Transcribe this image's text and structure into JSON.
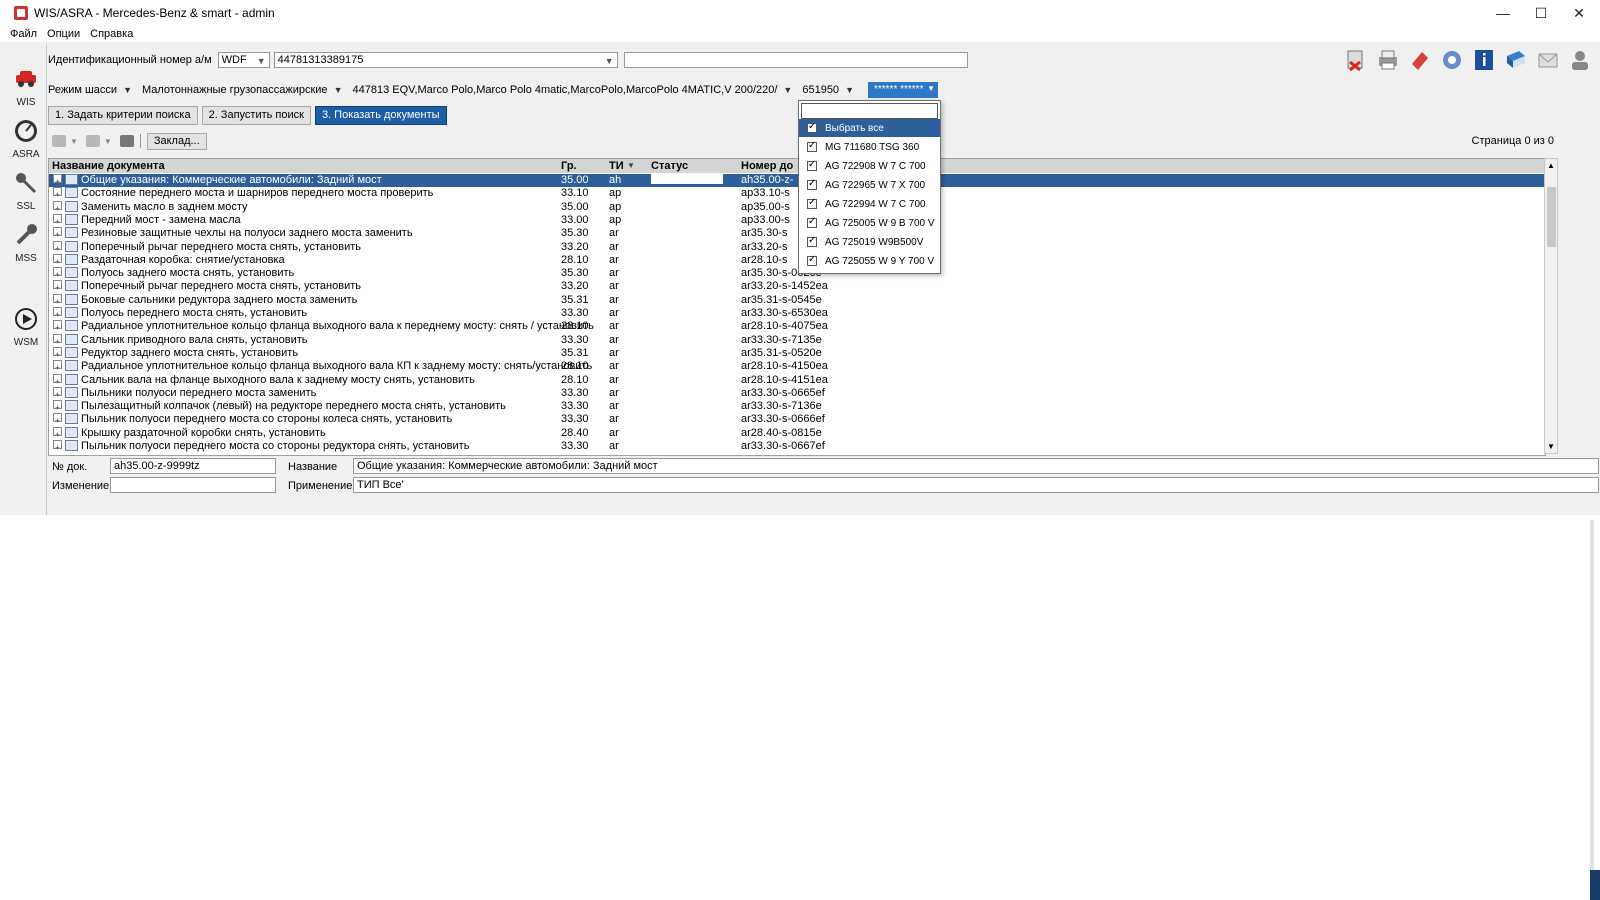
{
  "window": {
    "title": "WIS/ASRA - Mercedes-Benz & smart - admin"
  },
  "menu": [
    "Файл",
    "Опции",
    "Справка"
  ],
  "sidebar": [
    {
      "label": "WIS",
      "icon": "car-icon"
    },
    {
      "label": "ASRA",
      "icon": "gauge-icon"
    },
    {
      "label": "SSL",
      "icon": "key-icon"
    },
    {
      "label": "MSS",
      "icon": "wrench-icon"
    },
    {
      "label": "WSM",
      "icon": "play-icon"
    }
  ],
  "vin": {
    "label": "Идентификационный номер а/м",
    "prefix": "WDF",
    "number": "44781313389175"
  },
  "toolbar_icons": [
    "delete-icon",
    "print-icon",
    "eraser-icon",
    "settings-icon",
    "info-icon",
    "book-icon",
    "mail-icon",
    "user-icon"
  ],
  "criteria": {
    "mode": "Режим шасси",
    "category": "Малотоннажные грузопассажирские",
    "model": "447813 EQV,Marco Polo,Marco Polo 4matic,MarcoPolo,MarcoPolo 4MATIC,V 200/220/",
    "code": "651950",
    "extra": "****** ******"
  },
  "steps": [
    {
      "label": "1. Задать критерии поиска"
    },
    {
      "label": "2. Запустить поиск"
    },
    {
      "label": "3. Показать документы"
    }
  ],
  "bookmark_label": "Заклад...",
  "page_info": "Страница 0 из 0",
  "table": {
    "headers": [
      "Название документа",
      "Гр.",
      "ТИ",
      "Статус",
      "Номер до"
    ],
    "rows": [
      {
        "name": "Общие указания: Коммерческие автомобили: Задний мост",
        "gr": "35.00",
        "ti": "ah",
        "num": "ah35.00-z-",
        "selected": true
      },
      {
        "name": "Состояние переднего моста и шарниров переднего моста проверить",
        "gr": "33.10",
        "ti": "ap",
        "num": "ap33.10-s"
      },
      {
        "name": "Заменить масло в заднем мосту",
        "gr": "35.00",
        "ti": "ap",
        "num": "ap35.00-s"
      },
      {
        "name": "Передний мост - замена масла",
        "gr": "33.00",
        "ti": "ap",
        "num": "ap33.00-s"
      },
      {
        "name": "Резиновые защитные чехлы на полуоси заднего моста заменить",
        "gr": "35.30",
        "ti": "ar",
        "num": "ar35.30-s"
      },
      {
        "name": "Поперечный рычаг переднего моста снять, установить",
        "gr": "33.20",
        "ti": "ar",
        "num": "ar33.20-s"
      },
      {
        "name": "Раздаточная коробка: снятие/установка",
        "gr": "28.10",
        "ti": "ar",
        "num": "ar28.10-s"
      },
      {
        "name": "Полуось заднего моста снять, установить",
        "gr": "35.30",
        "ti": "ar",
        "num": "ar35.30-s-0620e"
      },
      {
        "name": "Поперечный рычаг переднего моста снять, установить",
        "gr": "33.20",
        "ti": "ar",
        "num": "ar33.20-s-1452ea"
      },
      {
        "name": "Боковые сальники редуктора заднего моста заменить",
        "gr": "35.31",
        "ti": "ar",
        "num": "ar35.31-s-0545e"
      },
      {
        "name": "Полуось переднего моста снять, установить",
        "gr": "33.30",
        "ti": "ar",
        "num": "ar33.30-s-6530ea"
      },
      {
        "name": "Радиальное уплотнительное кольцо фланца выходного вала к переднему мосту: снять / установить",
        "gr": "28.10",
        "ti": "ar",
        "num": "ar28.10-s-4075ea"
      },
      {
        "name": "Сальник приводного вала снять, установить",
        "gr": "33.30",
        "ti": "ar",
        "num": "ar33.30-s-7135e"
      },
      {
        "name": "Редуктор заднего моста снять, установить",
        "gr": "35.31",
        "ti": "ar",
        "num": "ar35.31-s-0520e"
      },
      {
        "name": "Радиальное уплотнительное кольцо фланца выходного вала КП к заднему мосту: снять/установить",
        "gr": "28.10",
        "ti": "ar",
        "num": "ar28.10-s-4150ea"
      },
      {
        "name": "Сальник вала на фланце выходного вала к заднему мосту снять, установить",
        "gr": "28.10",
        "ti": "ar",
        "num": "ar28.10-s-4151ea"
      },
      {
        "name": "Пыльники полуоси переднего моста заменить",
        "gr": "33.30",
        "ti": "ar",
        "num": "ar33.30-s-0665ef"
      },
      {
        "name": "Пылезащитный колпачок (левый) на редукторе переднего моста снять, установить",
        "gr": "33.30",
        "ti": "ar",
        "num": "ar33.30-s-7136e"
      },
      {
        "name": "Пыльник полуоси переднего моста со стороны колеса снять, установить",
        "gr": "33.30",
        "ti": "ar",
        "num": "ar33.30-s-0666ef"
      },
      {
        "name": "Крышку раздаточной коробки снять, установить",
        "gr": "28.40",
        "ti": "ar",
        "num": "ar28.40-s-0815e"
      },
      {
        "name": "Пыльник полуоси переднего моста со стороны редуктора снять, установить",
        "gr": "33.30",
        "ti": "ar",
        "num": "ar33.30-s-0667ef"
      }
    ]
  },
  "details": {
    "doc_no_label": "№ док.",
    "doc_no": "ah35.00-z-9999tz",
    "name_label": "Название",
    "name": "Общие указания: Коммерческие автомобили: Задний мост",
    "change_label": "Изменение",
    "change": "",
    "application_label": "Применение",
    "application": "ТИП Все'"
  },
  "dropdown": {
    "items": [
      {
        "label": "Выбрать все",
        "checked": true,
        "highlight": true
      },
      {
        "label": "MG 711680 TSG 360",
        "checked": true
      },
      {
        "label": "AG 722908 W 7 C 700",
        "checked": true
      },
      {
        "label": "AG 722965 W 7 X 700",
        "checked": true
      },
      {
        "label": "AG 722994 W 7 C 700",
        "checked": true
      },
      {
        "label": "AG 725005 W 9 B 700 V",
        "checked": true
      },
      {
        "label": "AG 725019 W9B500V",
        "checked": true
      },
      {
        "label": "AG 725055 W 9 Y 700 V",
        "checked": true
      }
    ]
  }
}
